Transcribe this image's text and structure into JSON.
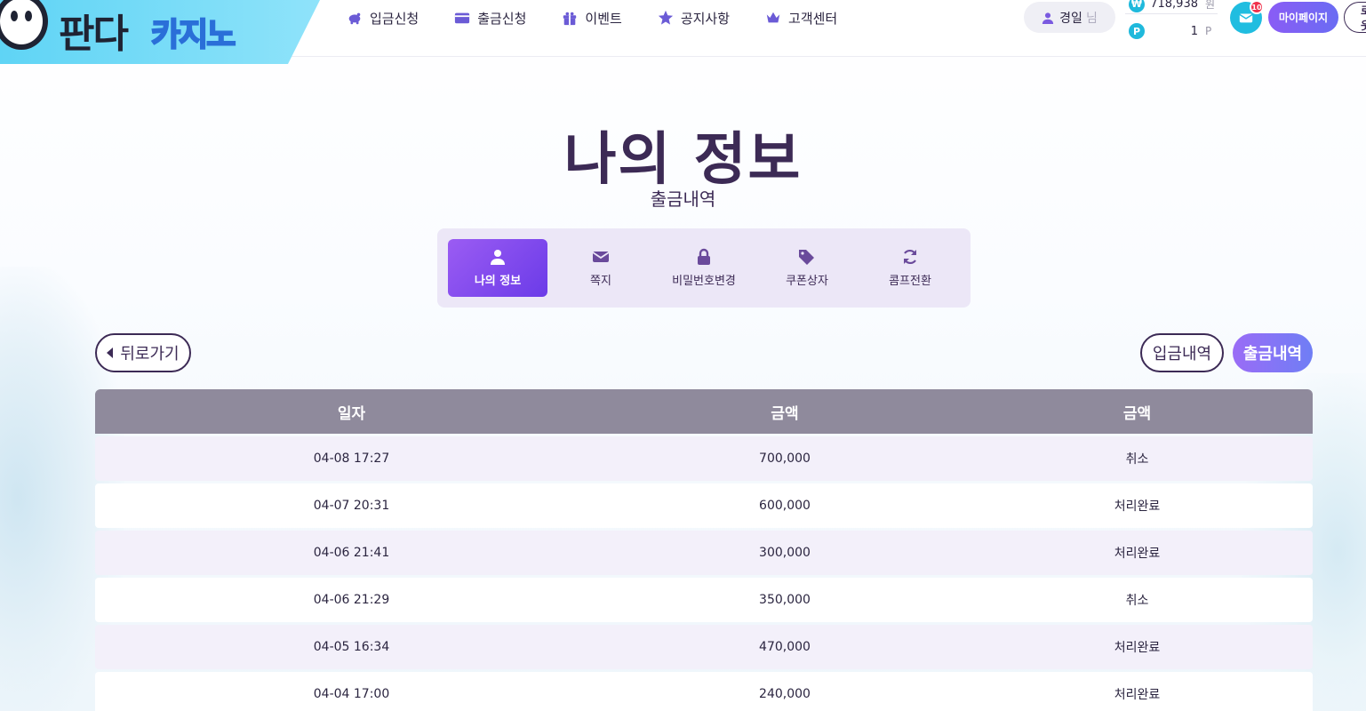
{
  "header": {
    "logo_main": "판다",
    "logo_sub": "카지노",
    "nav": [
      {
        "label": "입금신청",
        "icon": "piggy-bank-icon"
      },
      {
        "label": "출금신청",
        "icon": "credit-card-icon"
      },
      {
        "label": "이벤트",
        "icon": "gift-icon"
      },
      {
        "label": "공지사항",
        "icon": "star-icon"
      },
      {
        "label": "고객센터",
        "icon": "crown-icon"
      }
    ],
    "user": {
      "name": "경일",
      "suffix": "님"
    },
    "balance": {
      "won_symbol": "₩",
      "won_value": "718,938",
      "won_unit": "원",
      "point_symbol": "P",
      "point_value": "1",
      "point_unit": "P"
    },
    "message_badge": "10",
    "mypage_label": "마이페이지",
    "logout_label": "로그아웃"
  },
  "page": {
    "title": "나의 정보",
    "subtitle": "출금내역"
  },
  "tabs": [
    {
      "label": "나의 정보",
      "icon": "user-icon",
      "active": true
    },
    {
      "label": "쪽지",
      "icon": "envelope-icon",
      "active": false
    },
    {
      "label": "비밀번호변경",
      "icon": "lock-icon",
      "active": false
    },
    {
      "label": "쿠폰상자",
      "icon": "tags-icon",
      "active": false
    },
    {
      "label": "콤프전환",
      "icon": "refresh-icon",
      "active": false
    }
  ],
  "actions": {
    "back_label": "뒤로가기",
    "deposit_history_label": "입금내역",
    "withdraw_history_label": "출금내역"
  },
  "table": {
    "headers": [
      "일자",
      "금액",
      "금액"
    ],
    "rows": [
      [
        "04-08 17:27",
        "700,000",
        "취소"
      ],
      [
        "04-07 20:31",
        "600,000",
        "처리완료"
      ],
      [
        "04-06 21:41",
        "300,000",
        "처리완료"
      ],
      [
        "04-06 21:29",
        "350,000",
        "취소"
      ],
      [
        "04-05 16:34",
        "470,000",
        "처리완료"
      ],
      [
        "04-04 17:00",
        "240,000",
        "처리완료"
      ]
    ]
  },
  "colors": {
    "accent": "#8a5cf5",
    "title": "#3c2a55",
    "header_row": "#8f8a9c",
    "logo_bg": "#5fd4f5"
  }
}
